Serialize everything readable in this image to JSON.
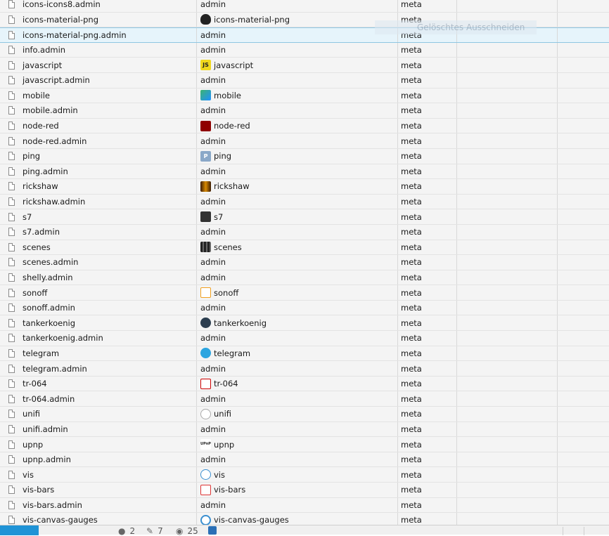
{
  "rows": [
    {
      "name": "icons-icons8.admin",
      "object": "admin",
      "type": "meta",
      "icon": ""
    },
    {
      "name": "icons-material-png",
      "object": "icons-material-png",
      "type": "meta",
      "icon": "cloud-check-icon"
    },
    {
      "name": "icons-material-png.admin",
      "object": "admin",
      "type": "meta",
      "icon": "",
      "selected": true
    },
    {
      "name": "info.admin",
      "object": "admin",
      "type": "meta",
      "icon": ""
    },
    {
      "name": "javascript",
      "object": "javascript",
      "type": "meta",
      "icon": "javascript-icon",
      "icon_text": "JS"
    },
    {
      "name": "javascript.admin",
      "object": "admin",
      "type": "meta",
      "icon": ""
    },
    {
      "name": "mobile",
      "object": "mobile",
      "type": "meta",
      "icon": "mobile-icon"
    },
    {
      "name": "mobile.admin",
      "object": "admin",
      "type": "meta",
      "icon": ""
    },
    {
      "name": "node-red",
      "object": "node-red",
      "type": "meta",
      "icon": "node-red-icon"
    },
    {
      "name": "node-red.admin",
      "object": "admin",
      "type": "meta",
      "icon": ""
    },
    {
      "name": "ping",
      "object": "ping",
      "type": "meta",
      "icon": "ping-icon",
      "icon_text": "P"
    },
    {
      "name": "ping.admin",
      "object": "admin",
      "type": "meta",
      "icon": ""
    },
    {
      "name": "rickshaw",
      "object": "rickshaw",
      "type": "meta",
      "icon": "rickshaw-icon"
    },
    {
      "name": "rickshaw.admin",
      "object": "admin",
      "type": "meta",
      "icon": ""
    },
    {
      "name": "s7",
      "object": "s7",
      "type": "meta",
      "icon": "s7-icon"
    },
    {
      "name": "s7.admin",
      "object": "admin",
      "type": "meta",
      "icon": ""
    },
    {
      "name": "scenes",
      "object": "scenes",
      "type": "meta",
      "icon": "clapperboard-icon"
    },
    {
      "name": "scenes.admin",
      "object": "admin",
      "type": "meta",
      "icon": ""
    },
    {
      "name": "shelly.admin",
      "object": "admin",
      "type": "meta",
      "icon": ""
    },
    {
      "name": "sonoff",
      "object": "sonoff",
      "type": "meta",
      "icon": "sonoff-icon"
    },
    {
      "name": "sonoff.admin",
      "object": "admin",
      "type": "meta",
      "icon": ""
    },
    {
      "name": "tankerkoenig",
      "object": "tankerkoenig",
      "type": "meta",
      "icon": "fuel-pump-icon"
    },
    {
      "name": "tankerkoenig.admin",
      "object": "admin",
      "type": "meta",
      "icon": ""
    },
    {
      "name": "telegram",
      "object": "telegram",
      "type": "meta",
      "icon": "telegram-icon"
    },
    {
      "name": "telegram.admin",
      "object": "admin",
      "type": "meta",
      "icon": ""
    },
    {
      "name": "tr-064",
      "object": "tr-064",
      "type": "meta",
      "icon": "tr-064-icon"
    },
    {
      "name": "tr-064.admin",
      "object": "admin",
      "type": "meta",
      "icon": ""
    },
    {
      "name": "unifi",
      "object": "unifi",
      "type": "meta",
      "icon": "unifi-icon"
    },
    {
      "name": "unifi.admin",
      "object": "admin",
      "type": "meta",
      "icon": ""
    },
    {
      "name": "upnp",
      "object": "upnp",
      "type": "meta",
      "icon": "upnp-icon",
      "icon_text": "UPnP"
    },
    {
      "name": "upnp.admin",
      "object": "admin",
      "type": "meta",
      "icon": ""
    },
    {
      "name": "vis",
      "object": "vis",
      "type": "meta",
      "icon": "vis-gauge-icon"
    },
    {
      "name": "vis-bars",
      "object": "vis-bars",
      "type": "meta",
      "icon": "vis-bars-icon"
    },
    {
      "name": "vis-bars.admin",
      "object": "admin",
      "type": "meta",
      "icon": ""
    },
    {
      "name": "vis-canvas-gauges",
      "object": "vis-canvas-gauges",
      "type": "meta",
      "icon": "canvas-gauge-icon"
    }
  ],
  "tooltip": {
    "text": "Gelöschtes Ausschneiden"
  },
  "statusbar": {
    "users_count": "2",
    "edits_count": "7",
    "views_count": "25"
  },
  "colors": {
    "accent": "#1f93d6",
    "selected_row": "#e6f4fb"
  }
}
